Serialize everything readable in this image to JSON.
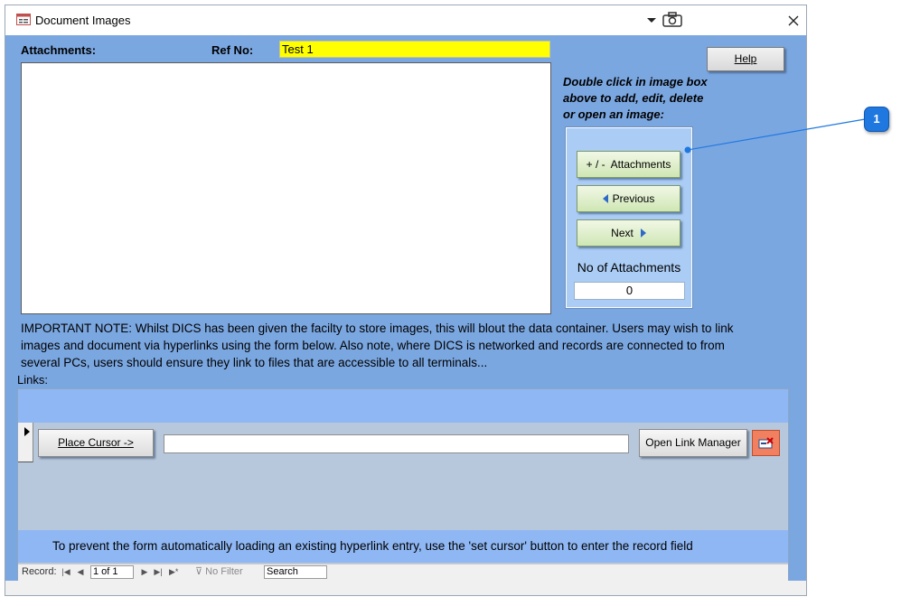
{
  "window": {
    "title": "Document Images",
    "title_icon": "form-icon"
  },
  "titlebar": {
    "dropdown_icon": "chevron-down-icon",
    "camera_icon": "camera-icon",
    "close_icon": "close-icon"
  },
  "form": {
    "attachments_label": "Attachments:",
    "ref_label": "Ref No:",
    "ref_value": "Test 1",
    "help_label": "Help",
    "hint": "Double click in image box above to add, edit, delete or open an image:",
    "attachments_button": "+ / -  Attachments",
    "previous_button": "Previous",
    "next_button": "Next",
    "count_label": "No of Attachments",
    "count_value": "0",
    "note": "IMPORTANT NOTE:  Whilst DICS has been given the facilty to store images, this will blout the data container.  Users may wish to link images and document via hyperlinks using the form below.  Also note, where DICS is networked and records are connected to from several PCs, users should ensure they link to files that are accessible to all terminals...",
    "links_label": "Links:"
  },
  "links": {
    "place_cursor_button": "Place Cursor ->",
    "link_value": "",
    "open_manager_button": "Open Link Manager",
    "delete_icon": "delete-link-icon",
    "footer_text": "To prevent the form automatically loading an existing hyperlink entry, use the 'set cursor' button to enter the record field"
  },
  "navigation": {
    "record_label": "Record:",
    "record_value": "1 of 1",
    "filter_label": "No Filter",
    "search_label": "Search"
  },
  "callout": {
    "number": "1"
  },
  "colors": {
    "form_bg": "#7ba7e1",
    "ref_highlight": "#ffff00",
    "panel_bg": "#aaccf5",
    "callout": "#1e78e0"
  }
}
